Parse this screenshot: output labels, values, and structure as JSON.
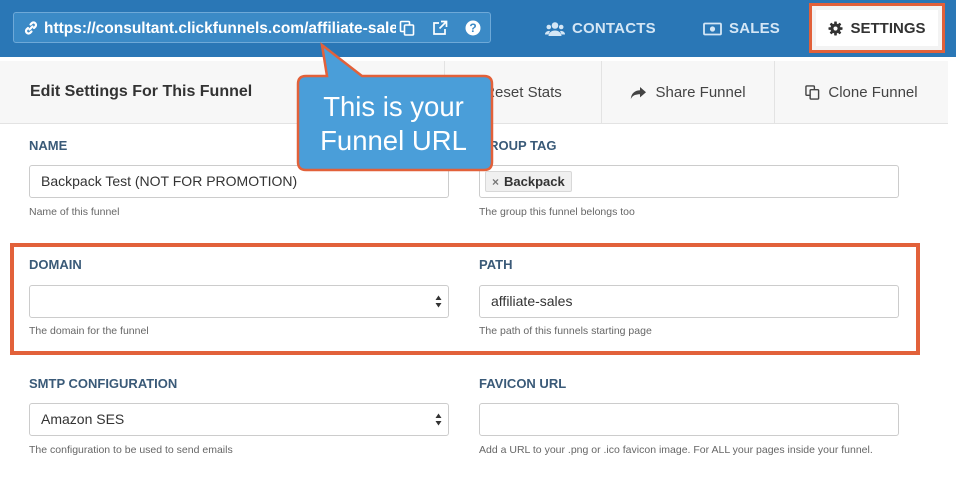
{
  "topbar": {
    "url": "https://consultant.clickfunnels.com/affiliate-sales",
    "nav": {
      "contacts": "CONTACTS",
      "sales": "SALES",
      "settings": "SETTINGS"
    }
  },
  "header": {
    "title": "Edit Settings For This Funnel",
    "reset_stats": "Reset Stats",
    "share_funnel": "Share Funnel",
    "clone_funnel": "Clone Funnel"
  },
  "form": {
    "name": {
      "label": "NAME",
      "value": "Backpack Test (NOT FOR PROMOTION)",
      "help": "Name of this funnel"
    },
    "group_tag": {
      "label": "GROUP TAG",
      "tag": "Backpack",
      "help": "The group this funnel belongs too"
    },
    "domain": {
      "label": "DOMAIN",
      "value": "",
      "help": "The domain for the funnel"
    },
    "path": {
      "label": "PATH",
      "value": "affiliate-sales",
      "help": "The path of this funnels starting page"
    },
    "smtp": {
      "label": "SMTP CONFIGURATION",
      "value": "Amazon SES",
      "help": "The configuration to be used to send emails"
    },
    "favicon": {
      "label": "FAVICON URL",
      "value": "",
      "help": "Add a URL to your .png or .ico favicon image. For ALL your pages inside your funnel."
    }
  },
  "callout": {
    "line1": "This is your",
    "line2": "Funnel URL"
  },
  "colors": {
    "topbar": "#2a77b6",
    "accent_orange": "#e2613a",
    "callout_blue": "#4a9ed9",
    "label_text": "#3a5a78"
  }
}
